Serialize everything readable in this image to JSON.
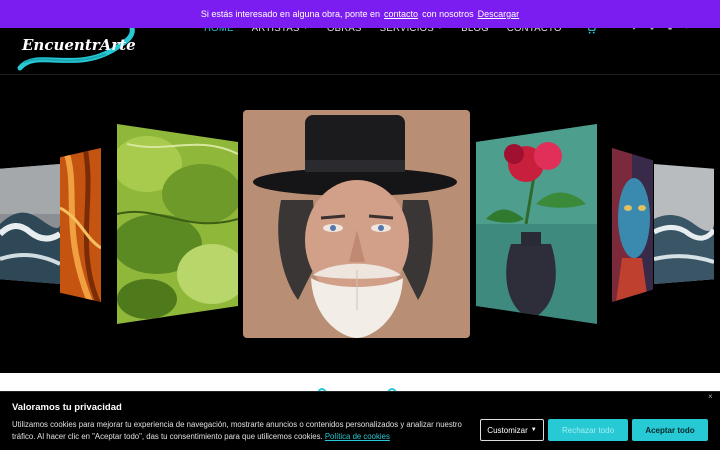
{
  "announcement": {
    "text_before": "Si estás interesado en alguna obra, ponte en",
    "link_contact": "contacto",
    "text_middle": "con nosotros",
    "link_download": "Descargar"
  },
  "header": {
    "logo_text": "EncuentrArte",
    "nav": [
      {
        "label": "HOME",
        "active": true
      },
      {
        "label": "ARTISTAS",
        "has_dropdown": true
      },
      {
        "label": "OBRAS"
      },
      {
        "label": "SERVICIOS",
        "has_dropdown": true
      },
      {
        "label": "BLOG"
      },
      {
        "label": "CONTACTO"
      }
    ],
    "icons": [
      "cart-icon",
      "heart-icon",
      "account-icon",
      "bag-icon",
      "search-icon"
    ]
  },
  "carousel": {
    "slides": [
      "sea-waves-painting",
      "orange-abstract-painting",
      "green-alcohol-ink-painting",
      "portrait-top-hat-painting",
      "red-flower-vase-painting",
      "colorful-face-painting",
      "stormy-sea-painting"
    ]
  },
  "cookie": {
    "title": "Valoramos tu privacidad",
    "body": "Utilizamos cookies para mejorar tu experiencia de navegación, mostrarte anuncios o contenidos personalizados y analizar nuestro tráfico. Al hacer clic en \"Aceptar todo\", das tu consentimiento para que utilicemos cookies.",
    "policy_link": "Política de cookies",
    "customize_label": "Customizar",
    "reject_label": "Rechazar todo",
    "accept_label": "Aceptar todo",
    "close_symbol": "×"
  },
  "colors": {
    "announce_bg": "#7b1df0",
    "accent": "#27c9d4",
    "background": "#000000"
  }
}
